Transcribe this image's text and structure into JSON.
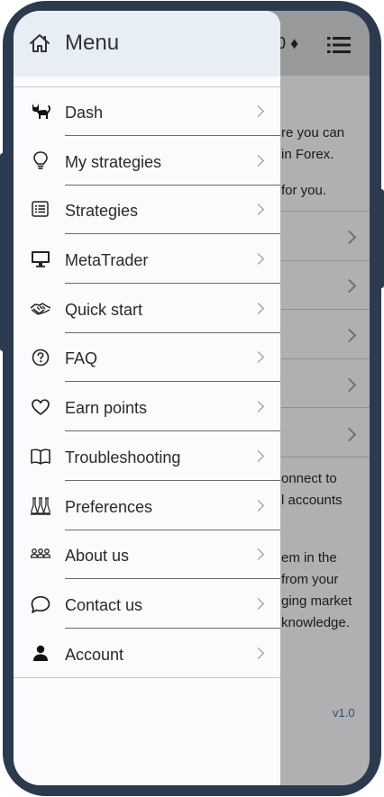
{
  "header": {
    "partial_value": "0 ♦"
  },
  "background": {
    "text_lines": [
      "re you can",
      "in Forex.",
      "for you.",
      "onnect to",
      "l accounts",
      "em in the",
      "from your",
      "ging market",
      "knowledge."
    ],
    "version": "v1.0"
  },
  "drawer": {
    "title": "Menu",
    "items": [
      {
        "label": "Dash",
        "icon": "cat-icon"
      },
      {
        "label": "My strategies",
        "icon": "lightbulb-icon"
      },
      {
        "label": "Strategies",
        "icon": "list-icon"
      },
      {
        "label": "MetaTrader",
        "icon": "monitor-icon"
      },
      {
        "label": "Quick start",
        "icon": "handshake-icon"
      },
      {
        "label": "FAQ",
        "icon": "question-circle-icon"
      },
      {
        "label": "Earn points",
        "icon": "heart-icon"
      },
      {
        "label": "Troubleshooting",
        "icon": "book-icon"
      },
      {
        "label": "Preferences",
        "icon": "flasks-icon"
      },
      {
        "label": "About us",
        "icon": "people-icon"
      },
      {
        "label": "Contact us",
        "icon": "chat-icon"
      },
      {
        "label": "Account",
        "icon": "person-icon"
      }
    ]
  }
}
